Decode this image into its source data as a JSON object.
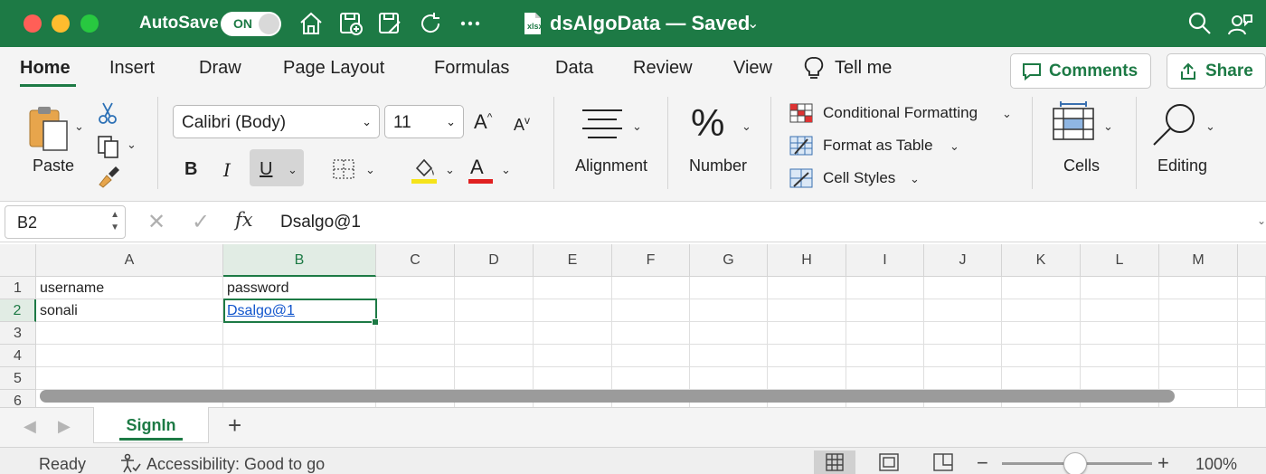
{
  "titlebar": {
    "autosave_label": "AutoSave",
    "autosave_state": "ON",
    "document_title": "dsAlgoData — Saved",
    "colors": {
      "background": "#1d7a45",
      "close": "#ff5f57",
      "minimize": "#febc2e",
      "zoom": "#28c840"
    },
    "icons": [
      "home-icon",
      "save-as-icon",
      "save-icon",
      "redo-icon",
      "more-icon",
      "search-icon",
      "profile-icon"
    ]
  },
  "ribbon": {
    "tabs": [
      "Home",
      "Insert",
      "Draw",
      "Page Layout",
      "Formulas",
      "Data",
      "Review",
      "View"
    ],
    "active_tab": "Home",
    "tell_me": "Tell me",
    "comments_label": "Comments",
    "share_label": "Share",
    "paste_label": "Paste",
    "font_name": "Calibri (Body)",
    "font_size": "11",
    "bold": "B",
    "italic": "I",
    "underline": "U",
    "font_color_letter": "A",
    "alignment_label": "Alignment",
    "number_label": "Number",
    "conditional_formatting": "Conditional Formatting",
    "format_as_table": "Format as Table",
    "cell_styles": "Cell Styles",
    "cells_label": "Cells",
    "editing_label": "Editing",
    "highlight_color": "#f5e31a",
    "font_color": "#e02020"
  },
  "formula_bar": {
    "name_box": "B2",
    "fx": "fx",
    "value": "Dsalgo@1"
  },
  "grid": {
    "columns": [
      "A",
      "B",
      "C",
      "D",
      "E",
      "F",
      "G",
      "H",
      "I",
      "J",
      "K",
      "L",
      "M"
    ],
    "rows": [
      "1",
      "2",
      "3",
      "4",
      "5",
      "6"
    ],
    "cells": {
      "A1": "username",
      "B1": "password",
      "A2": "sonali",
      "B2": "Dsalgo@1"
    },
    "selected_cell": "B2"
  },
  "sheets": {
    "tabs": [
      "SignIn"
    ],
    "active": "SignIn",
    "add_label": "+"
  },
  "statusbar": {
    "ready": "Ready",
    "accessibility": "Accessibility: Good to go",
    "zoom": "100%",
    "zoom_minus": "−",
    "zoom_plus": "+"
  }
}
